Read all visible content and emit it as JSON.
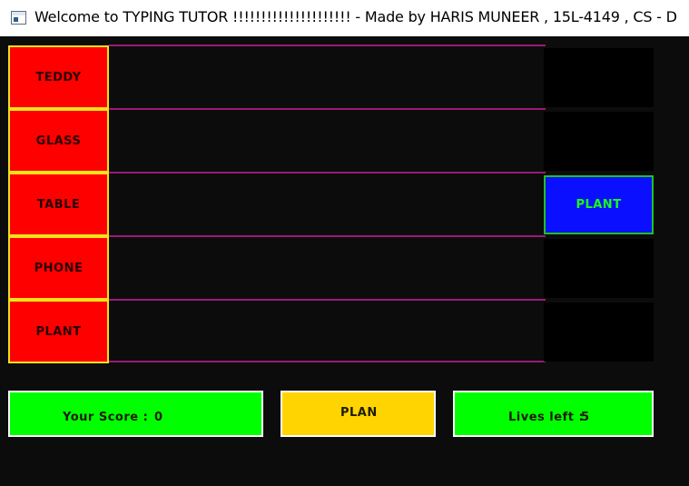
{
  "window": {
    "title": "Welcome to TYPING TUTOR !!!!!!!!!!!!!!!!!!!!!  -  Made by HARIS MUNEER , 15L-4149 , CS - D",
    "icon": "application-window-icon"
  },
  "words": [
    "TEDDY",
    "GLASS",
    "TABLE",
    "PHONE",
    "PLANT"
  ],
  "falling_word": {
    "text": "PLANT",
    "row": 3
  },
  "score": {
    "label": "Your Score :",
    "value": "0"
  },
  "typed_input": "PLAN",
  "lives": {
    "label": "Lives left :",
    "value": "5"
  },
  "colors": {
    "background": "#0c0c0c",
    "word_box": "#ff0000",
    "word_border": "#f2e21d",
    "lane_line": "#9b1a77",
    "active_slot": "#0a10ff",
    "active_text": "#18ff18",
    "score_panel": "#00ff00",
    "input_panel": "#ffd400",
    "lives_panel": "#00ff00"
  }
}
